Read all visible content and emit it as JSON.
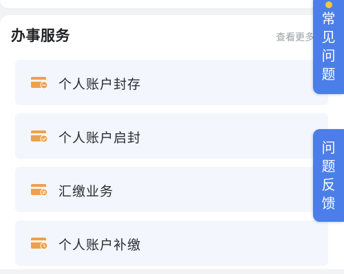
{
  "section": {
    "title": "办事服务",
    "more_label": "查看更多"
  },
  "items": [
    {
      "label": "个人账户封存",
      "icon": "card-minus-icon"
    },
    {
      "label": "个人账户启封",
      "icon": "card-check-icon"
    },
    {
      "label": "汇缴业务",
      "icon": "card-transfer-icon"
    },
    {
      "label": "个人账户补缴",
      "icon": "card-clock-icon"
    }
  ],
  "float_tabs": {
    "faq": "常见问题",
    "feedback": "问题反馈"
  },
  "colors": {
    "accent_blue": "#4b7ee8",
    "icon_orange": "#eea04b",
    "item_bg": "#f3f6fc"
  }
}
